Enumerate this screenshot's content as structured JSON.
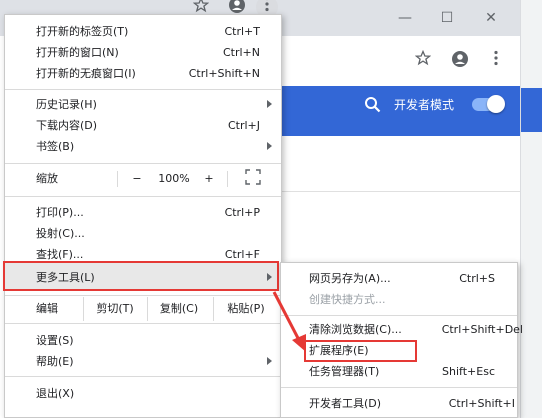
{
  "colors": {
    "accent": "#3367d6",
    "highlight_box": "#e53935"
  },
  "background_page": {
    "title_controls": [
      "—",
      "☐",
      "✕"
    ],
    "search_icon": "search-icon",
    "developer_mode_label": "开发者模式",
    "developer_mode_on": 1
  },
  "main_menu": {
    "items": [
      {
        "label": "打开新的标签页(T)",
        "shortcut": "Ctrl+T"
      },
      {
        "label": "打开新的窗口(N)",
        "shortcut": "Ctrl+N"
      },
      {
        "label": "打开新的无痕窗口(I)",
        "shortcut": "Ctrl+Shift+N"
      },
      {
        "label": "历史记录(H)",
        "shortcut": ""
      },
      {
        "label": "下载内容(D)",
        "shortcut": "Ctrl+J"
      },
      {
        "label": "书签(B)",
        "shortcut": ""
      },
      {
        "label": "打印(P)...",
        "shortcut": "Ctrl+P"
      },
      {
        "label": "投射(C)...",
        "shortcut": ""
      },
      {
        "label": "查找(F)...",
        "shortcut": "Ctrl+F"
      },
      {
        "label": "更多工具(L)",
        "shortcut": ""
      },
      {
        "label": "设置(S)",
        "shortcut": ""
      },
      {
        "label": "帮助(E)",
        "shortcut": ""
      },
      {
        "label": "退出(X)",
        "shortcut": ""
      }
    ],
    "zoom": {
      "label": "缩放",
      "minus": "−",
      "value": "100%",
      "plus": "+"
    },
    "edit": {
      "label": "编辑",
      "cut": "剪切(T)",
      "copy": "复制(C)",
      "paste": "粘贴(P)"
    }
  },
  "submenu": {
    "items": [
      {
        "label": "网页另存为(A)...",
        "shortcut": "Ctrl+S"
      },
      {
        "label": "创建快捷方式...",
        "shortcut": ""
      },
      {
        "label": "清除浏览数据(C)...",
        "shortcut": "Ctrl+Shift+Del"
      },
      {
        "label": "扩展程序(E)",
        "shortcut": ""
      },
      {
        "label": "任务管理器(T)",
        "shortcut": "Shift+Esc"
      },
      {
        "label": "开发者工具(D)",
        "shortcut": "Ctrl+Shift+I"
      }
    ]
  }
}
